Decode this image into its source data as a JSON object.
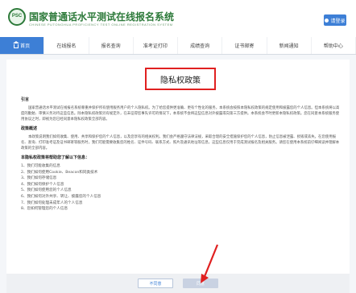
{
  "header": {
    "logo_text": "PSC",
    "site_title": "国家普通话水平测试在线报名系统",
    "site_subtitle": "CHINESE PUTONGHUA PROFICIENCY TEST ONLINE REGISTRATION SYSTEM",
    "login_label": "请登录"
  },
  "nav": {
    "items": [
      {
        "label": "首页"
      },
      {
        "label": "在线报名"
      },
      {
        "label": "报名查询"
      },
      {
        "label": "准考证打印"
      },
      {
        "label": "成绩查询"
      },
      {
        "label": "证书邮寄"
      },
      {
        "label": "新闻通知"
      },
      {
        "label": "帮助中心"
      }
    ]
  },
  "policy": {
    "title": "隐私权政策",
    "intro_heading": "引言",
    "intro_text": "国家普通话水平测试在线报名系统尊重并保护所有使用服务用户的个人隐私权。为了给您提供更准确、更有个性化的服务，本系统会按照本隐私权政策的规定使用和披露您的个人信息。但本系统将以高度的勤勉、审慎义务对待这些信息。除本隐私权政策另有规定外，在未征得您事先许可的情况下，本系统不会将这些信息对外披露或向第三方提供。本系统会不时更新本隐私权政策。您在同意本系统服务使用协议之时，即视为您已经同意本隐私权政策全部内容。",
    "summary_heading": "政策概述",
    "summary_text": "本政策说明我们如何收集、使用、共享和保护您的个人信息，以及您享有的相关权利。我们会严格遵守法律法规，采取合理的安全措施保护您的个人信息，防止信息被泄露、损毁或丢失。在您使用报名、查询、打印准考证及证书邮寄等服务时，我们可能需要收集您的姓名、证件号码、联系方式、照片及通讯地址等信息，这些信息仅用于完成测试报名及相关服务。请您在使用本系统前仔细阅读并理解本政策的全部内容。",
    "list_heading": "本隐私权政策将帮助您了解以下信息：",
    "list_items": [
      "1、我们可能收集的信息",
      "2、我们如何使用Cookie、Beacon和同类技术",
      "3、我们如何存储信息",
      "4、我们如何保护个人信息",
      "5、我们如何使用您的个人信息",
      "6、我们如何对外共享、转让、披露您的个人信息",
      "7、我们如何处理未成年人的个人信息",
      "8、您如何管理您的个人信息"
    ]
  },
  "footer": {
    "reject_label": "不同意",
    "agree_label": "同意"
  },
  "colors": {
    "accent": "#3d7fd6",
    "brand_green": "#2d7a3a",
    "highlight_red": "#e02020"
  }
}
